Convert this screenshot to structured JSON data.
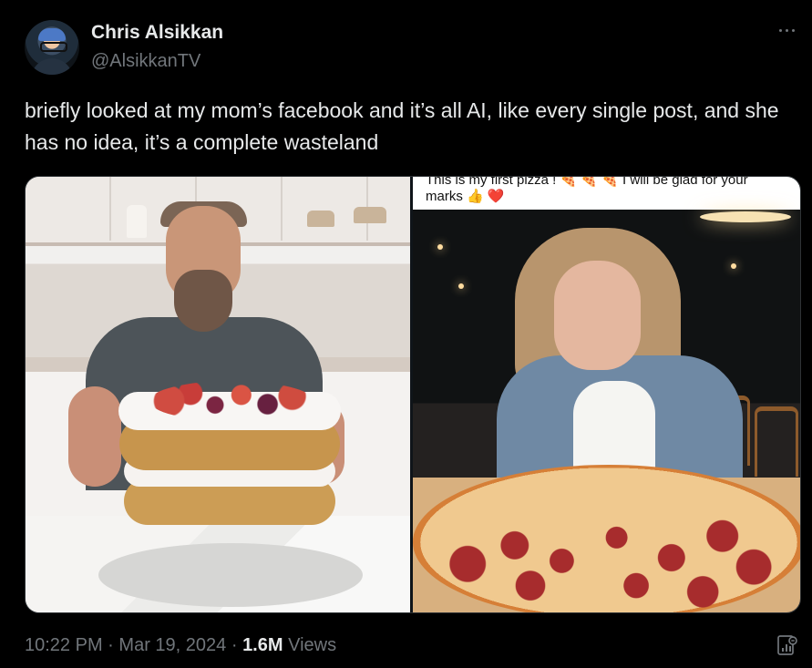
{
  "tweet": {
    "author_name": "Chris Alsikkan",
    "author_handle": "@AlsikkanTV",
    "body": "briefly looked at my mom’s facebook and it’s all AI, like every single post, and she has no idea, it’s a complete wasteland",
    "timestamp": "10:22 PM",
    "separator1": "·",
    "date": "Mar 19, 2024",
    "separator2": "·",
    "views_count": "1.6M",
    "views_label": "Views"
  },
  "media": {
    "right_caption_line1": "This is my first pizza ! 🍕 🍕 🍕 I will be glad for your",
    "right_caption_line2": "marks 👍 ❤️"
  },
  "icons": {
    "more": "more-icon",
    "analytics": "analytics-icon"
  },
  "colors": {
    "background": "#000000",
    "text_primary": "#e7e9ea",
    "text_secondary": "#71767b",
    "border": "#2f3336"
  }
}
